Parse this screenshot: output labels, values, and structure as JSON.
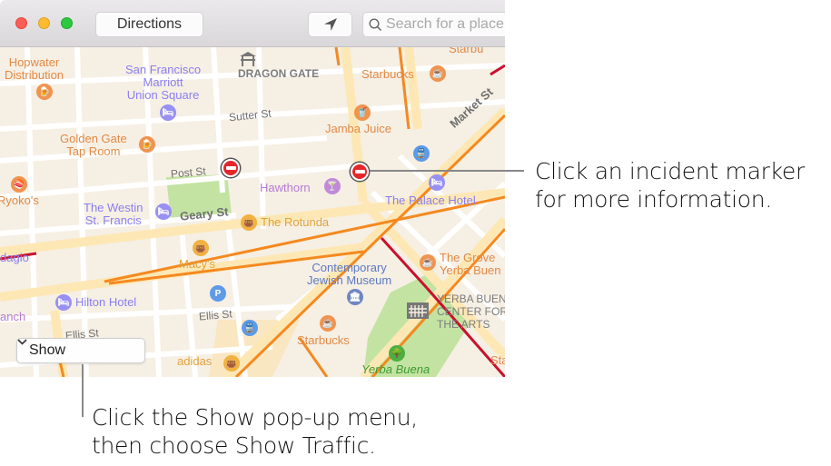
{
  "window": {
    "controls": [
      "close",
      "minimize",
      "zoom"
    ],
    "toolbar": {
      "directions_label": "Directions",
      "location_icon": "location-arrow-icon",
      "search_icon": "magnifier-icon",
      "search_placeholder": "Search for a place or address",
      "search_visible_text": "Search for a pla"
    }
  },
  "map": {
    "places": [
      {
        "name": "Hopwater Distribution",
        "line1": "Hopwater",
        "line2": "Distribution",
        "category": "bar",
        "color": "#e38a45"
      },
      {
        "name": "San Francisco Marriott Union Square",
        "line1": "San Francisco",
        "line2": "Marriott",
        "line3": "Union Square",
        "category": "hotel",
        "color": "#8a7ff0"
      },
      {
        "name": "Dragon Gate",
        "line1": "DRAGON GATE",
        "category": "landmark",
        "color": "#7c7c7c"
      },
      {
        "name": "Starbucks (top)",
        "line1": "Starbucks",
        "category": "cafe",
        "color": "#e38a45"
      },
      {
        "name": "Starbucks (top-right)",
        "line1": "Starbu",
        "category": "cafe",
        "color": "#e38a45"
      },
      {
        "name": "Jamba Juice",
        "line1": "Jamba Juice",
        "category": "juice",
        "color": "#e38a45"
      },
      {
        "name": "Golden Gate Tap Room",
        "line1": "Golden Gate",
        "line2": "Tap Room",
        "category": "bar",
        "color": "#e38a45"
      },
      {
        "name": "Ryoko's",
        "line1": "Ryoko's",
        "category": "restaurant",
        "color": "#e38a45"
      },
      {
        "name": "The Westin St. Francis",
        "line1": "The Westin",
        "line2": "St. Francis",
        "category": "hotel",
        "color": "#8a7ff0"
      },
      {
        "name": "Hawthorn",
        "line1": "Hawthorn",
        "category": "nightlife",
        "color": "#b67bd3"
      },
      {
        "name": "The Palace Hotel",
        "line1": "The Palace Hotel",
        "category": "hotel",
        "color": "#8a7ff0"
      },
      {
        "name": "The Rotunda",
        "line1": "The Rotunda",
        "category": "shopping",
        "color": "#e2a33c"
      },
      {
        "name": "Macy's",
        "line1": "Macy's",
        "category": "shopping",
        "color": "#e2a33c"
      },
      {
        "name": "Adagio",
        "line1": "dagio",
        "category": "hotel",
        "color": "#8a7ff0"
      },
      {
        "name": "Contemporary Jewish Museum",
        "line1": "Contemporary",
        "line2": "Jewish Museum",
        "category": "museum",
        "color": "#5c79c4"
      },
      {
        "name": "The Grove Yerba Buena",
        "line1": "The Grove",
        "line2": "Yerba Buen",
        "category": "cafe",
        "color": "#e38a45"
      },
      {
        "name": "Hilton Hotel",
        "line1": "Hilton Hotel",
        "category": "hotel",
        "color": "#8a7ff0"
      },
      {
        "name": "Ranch",
        "line1": "anch",
        "category": "nightlife",
        "color": "#b67bd3"
      },
      {
        "name": "Yerba Buena Center for the Arts",
        "line1": "YERBA BUEN",
        "line2": "CENTER FOR",
        "line3": "THE ARTS",
        "category": "landmark",
        "color": "#7c7c7c"
      },
      {
        "name": "Starbucks (bottom)",
        "line1": "Starbucks",
        "category": "cafe",
        "color": "#e38a45"
      },
      {
        "name": "adidas",
        "line1": "adidas",
        "category": "shopping",
        "color": "#e2a33c"
      },
      {
        "name": "Yerba Buena Gardens",
        "line1": "Yerba Buena",
        "category": "park",
        "color": "#3d9a30"
      },
      {
        "name": "Sta",
        "line1": "Sta",
        "category": "cafe",
        "color": "#e38a45"
      }
    ],
    "streets": [
      "Sutter St",
      "Post St",
      "Geary St",
      "Market St",
      "Ellis St",
      "Ellis St"
    ],
    "incidents": [
      {
        "id": "incident-post-st",
        "label": "Traffic incident"
      },
      {
        "id": "incident-kearny",
        "label": "Traffic incident"
      }
    ],
    "poi_glyphs": {
      "bar": "🍺",
      "hotel": "🛏",
      "cafe": "☕",
      "juice": "🥤",
      "restaurant": "🍣",
      "nightlife": "🍸",
      "shopping": "👜",
      "museum": "🏛",
      "park": "🌳",
      "transit": "🚆",
      "parking": "P"
    },
    "show_menu": {
      "selected": "Show",
      "chevron_icon": "chevron-down-icon"
    }
  },
  "callouts": {
    "incident": {
      "line1": "Click an incident marker",
      "line2": "for more information."
    },
    "show_menu": {
      "line1": "Click the Show pop-up menu,",
      "line2": "then choose Show Traffic."
    }
  },
  "colors": {
    "map_background": "#f6efe4",
    "traffic_heavy": "#c8102e",
    "traffic_moderate": "#f5891f",
    "major_road": "#fde8b5",
    "park": "#c3e3a3",
    "incident_red": "#e5262b"
  }
}
